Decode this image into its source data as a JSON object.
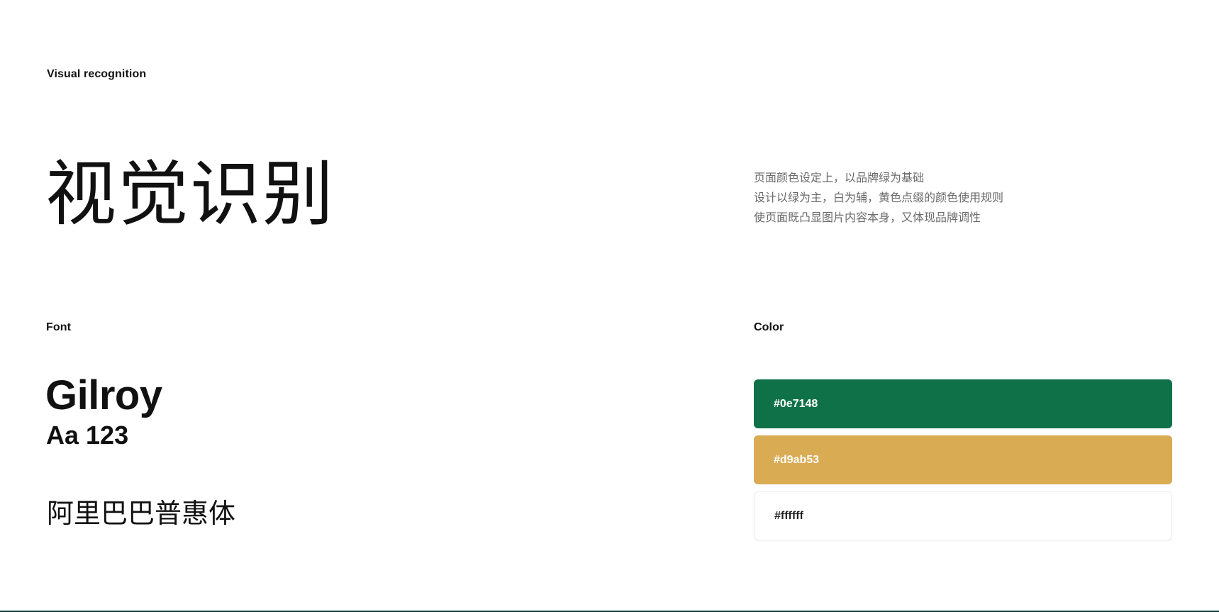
{
  "header": {
    "eyebrow": "Visual recognition",
    "title": "视觉识别"
  },
  "intro": {
    "lines": [
      "页面颜色设定上，以品牌绿为基础",
      "设计以绿为主，白为辅，黄色点缀的颜色使用规则",
      "使页面既凸显图片内容本身，又体现品牌调性"
    ]
  },
  "font": {
    "label": "Font",
    "name": "Gilroy",
    "sample": "Aa 123",
    "chinese_font": "阿里巴巴普惠体"
  },
  "color": {
    "label": "Color",
    "swatches": [
      {
        "hex": "#0e7148",
        "color": "#0e7148"
      },
      {
        "hex": "#d9ab53",
        "color": "#d9ab53"
      },
      {
        "hex": "#ffffff",
        "color": "#ffffff"
      }
    ]
  }
}
